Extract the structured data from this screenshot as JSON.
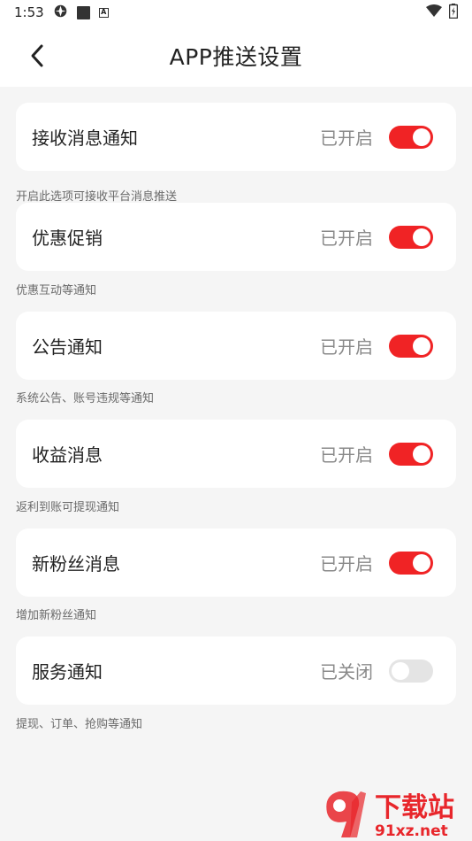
{
  "status_bar": {
    "time": "1:53",
    "mini_icon_letter": "A"
  },
  "header": {
    "title": "APP推送设置"
  },
  "settings": [
    {
      "label": "接收消息通知",
      "status": "已开启",
      "enabled": true,
      "desc": "开启此选项可接收平台消息推送"
    },
    {
      "label": "优惠促销",
      "status": "已开启",
      "enabled": true,
      "desc": "优惠互动等通知"
    },
    {
      "label": "公告通知",
      "status": "已开启",
      "enabled": true,
      "desc": "系统公告、账号违规等通知"
    },
    {
      "label": "收益消息",
      "status": "已开启",
      "enabled": true,
      "desc": "返利到账可提现通知"
    },
    {
      "label": "新粉丝消息",
      "status": "已开启",
      "enabled": true,
      "desc": "增加新粉丝通知"
    },
    {
      "label": "服务通知",
      "status": "已关闭",
      "enabled": false,
      "desc": "提现、订单、抢购等通知"
    }
  ],
  "watermark": {
    "text_top": "下载站",
    "text_bottom": "91xz.net"
  },
  "colors": {
    "toggle_on": "#f02325",
    "toggle_off": "#e4e4e4",
    "accent": "#f02325"
  }
}
